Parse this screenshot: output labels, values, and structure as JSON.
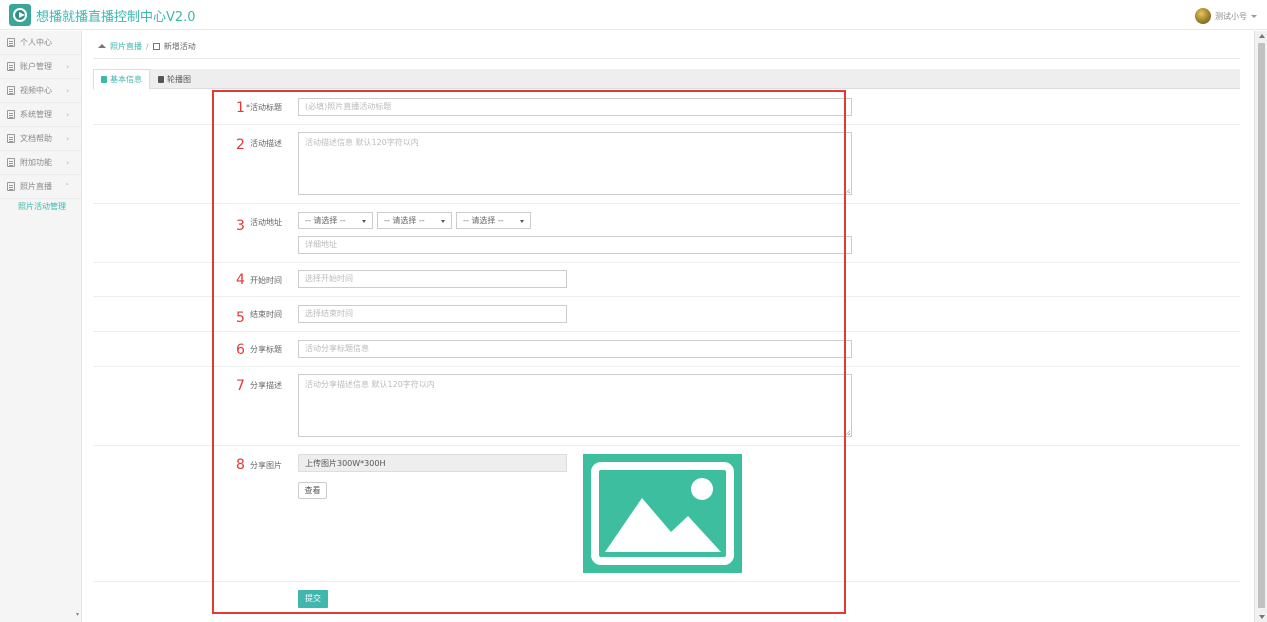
{
  "header": {
    "app_title": "想播就播直播控制中心V2.0",
    "user_name": "测试小号"
  },
  "sidebar": {
    "items": [
      {
        "label": "个人中心",
        "arrow": ""
      },
      {
        "label": "账户管理",
        "arrow": "›"
      },
      {
        "label": "视频中心",
        "arrow": "›"
      },
      {
        "label": "系统管理",
        "arrow": "›"
      },
      {
        "label": "文档帮助",
        "arrow": "›"
      },
      {
        "label": "附加功能",
        "arrow": "›"
      },
      {
        "label": "照片直播",
        "arrow": "˅"
      }
    ],
    "sub_item": "照片活动管理",
    "scroll_down": "▾"
  },
  "breadcrumb": {
    "link": "照片直播",
    "separator": "/",
    "current": "新增活动"
  },
  "tabs": [
    "基本信息",
    "轮播图"
  ],
  "annotations": [
    "1",
    "2",
    "3",
    "4",
    "5",
    "6",
    "7",
    "8"
  ],
  "form": {
    "title": {
      "label": "*活动标题",
      "placeholder": "(必填)照片直播活动标题"
    },
    "description": {
      "label": "活动描述",
      "placeholder": "活动描述信息 默认120字符以内"
    },
    "address": {
      "label": "活动地址",
      "selects": [
        "-- 请选择 --",
        "-- 请选择 --",
        "-- 请选择 --"
      ],
      "detail_placeholder": "详细地址"
    },
    "start_time": {
      "label": "开始时间",
      "placeholder": "选择开始时间"
    },
    "end_time": {
      "label": "结束时间",
      "placeholder": "选择结束时间"
    },
    "share_title": {
      "label": "分享标题",
      "placeholder": "活动分享标题信息"
    },
    "share_desc": {
      "label": "分享描述",
      "placeholder": "活动分享描述信息 默认120字符以内"
    },
    "share_image": {
      "label": "分享图片",
      "upload_hint": "上传图片300W*300H",
      "view_button": "查看"
    },
    "submit": "提交"
  },
  "colors": {
    "accent": "#3fb7ad",
    "annotation_red": "#e53935",
    "placeholder_image": "#3dbf9f"
  }
}
